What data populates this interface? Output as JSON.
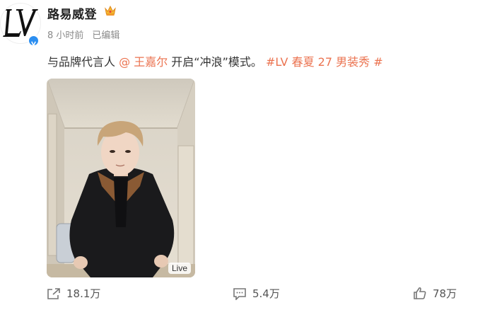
{
  "author": {
    "name": "路易威登",
    "logo_text": "LV",
    "badge": "crown-icon",
    "verified_icon": "verified-icon",
    "accent": "#2b8ef0"
  },
  "meta": {
    "time": "8 小时前",
    "edited": "已编辑"
  },
  "post": {
    "text_prefix": "与品牌代言人",
    "mention": "@ 王嘉尔",
    "text_middle": " 开启“冲浪”模式。",
    "hashtag": "#LV 春夏 27 男装秀 #",
    "link_color": "#eb7350"
  },
  "media": {
    "live_label": "Live"
  },
  "actions": {
    "share_count": "18.1万",
    "comment_count": "5.4万",
    "like_count": "78万"
  }
}
